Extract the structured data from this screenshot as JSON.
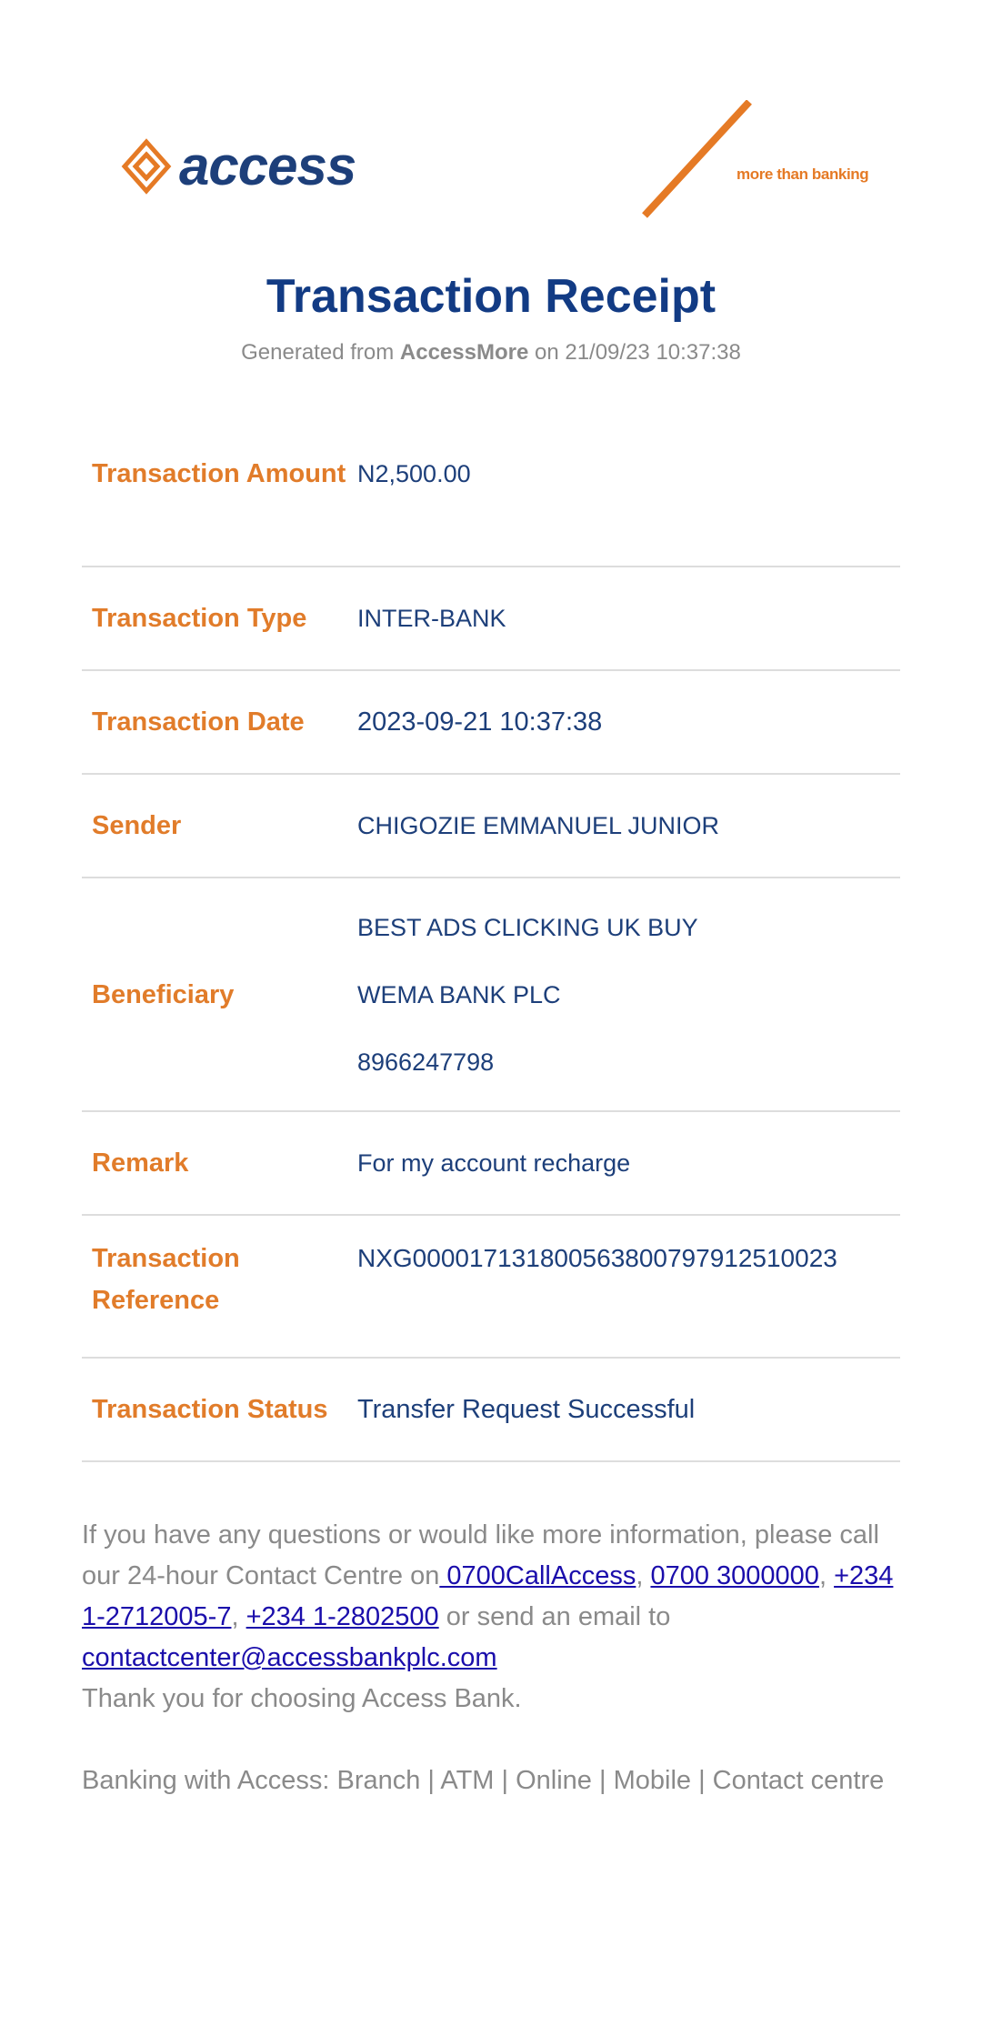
{
  "brand": {
    "logo_text": "access",
    "tagline": "more than banking",
    "colors": {
      "navy": "#123b84",
      "orange": "#e17c2a",
      "grey": "#8a8a8a",
      "link": "#1a0dab"
    }
  },
  "receipt": {
    "title": "Transaction Receipt",
    "generated_prefix": "Generated from",
    "generated_app": "AccessMore",
    "generated_on": "on 21/09/23 10:37:38"
  },
  "details": {
    "amount_label": "Transaction Amount",
    "amount_value": "N2,500.00",
    "type_label": "Transaction Type",
    "type_value": "INTER-BANK",
    "date_label": "Transaction Date",
    "date_value": "2023-09-21 10:37:38",
    "sender_label": "Sender",
    "sender_value": "CHIGOZIE EMMANUEL JUNIOR",
    "beneficiary_label": "Beneficiary",
    "beneficiary_name": "BEST ADS CLICKING UK BUY",
    "beneficiary_bank": "WEMA BANK PLC",
    "beneficiary_account": "8966247798",
    "remark_label": "Remark",
    "remark_value": "For my account recharge",
    "reference_label": "Transaction Reference",
    "reference_value": "NXG000017131800563800797912510023",
    "status_label": "Transaction Status",
    "status_value": "Transfer Request Successful"
  },
  "footer": {
    "intro": "If you have any questions or would like more information, please call our 24-hour Contact Centre on",
    "link_callaccess": " 0700CallAccess",
    "sep1": ", ",
    "link_phone1": "0700 3000000",
    "sep2": ", ",
    "link_phone2": "+234 1-2712005-7",
    "sep3": ", ",
    "link_phone3": "+234 1-2802500",
    "email_prefix": " or send an email to ",
    "link_email": "contactcenter@accessbankplc.com",
    "thanks": "Thank you for choosing Access Bank.",
    "banking_channels": "Banking with Access: Branch | ATM | Online | Mobile | Contact centre"
  }
}
